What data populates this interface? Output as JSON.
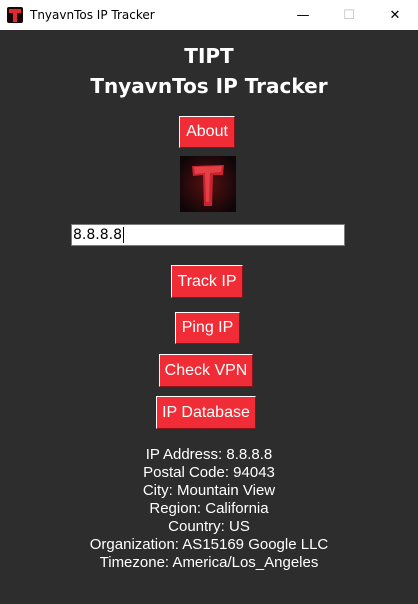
{
  "window": {
    "title": "TnyavnTos IP Tracker",
    "controls": {
      "minimize": "—",
      "maximize": "☐",
      "close": "✕"
    }
  },
  "header": {
    "line1": "TIPT",
    "line2": "TnyavnTos IP Tracker"
  },
  "buttons": {
    "about": "About",
    "track_ip": "Track IP",
    "ping_ip": "Ping IP",
    "check_vpn": "Check VPN",
    "ip_database": "IP Database"
  },
  "logo": {
    "letter": "T",
    "icon": "t-logo-icon"
  },
  "input": {
    "value": "8.8.8.8"
  },
  "results": {
    "ip": "IP Address: 8.8.8.8",
    "postal": "Postal Code: 94043",
    "city": "City: Mountain View",
    "region": "Region: California",
    "country": "Country: US",
    "org": "Organization: AS15169 Google LLC",
    "timezone": "Timezone: America/Los_Angeles"
  },
  "colors": {
    "background": "#2d2d2d",
    "button": "#f02d36",
    "text": "#ffffff"
  }
}
